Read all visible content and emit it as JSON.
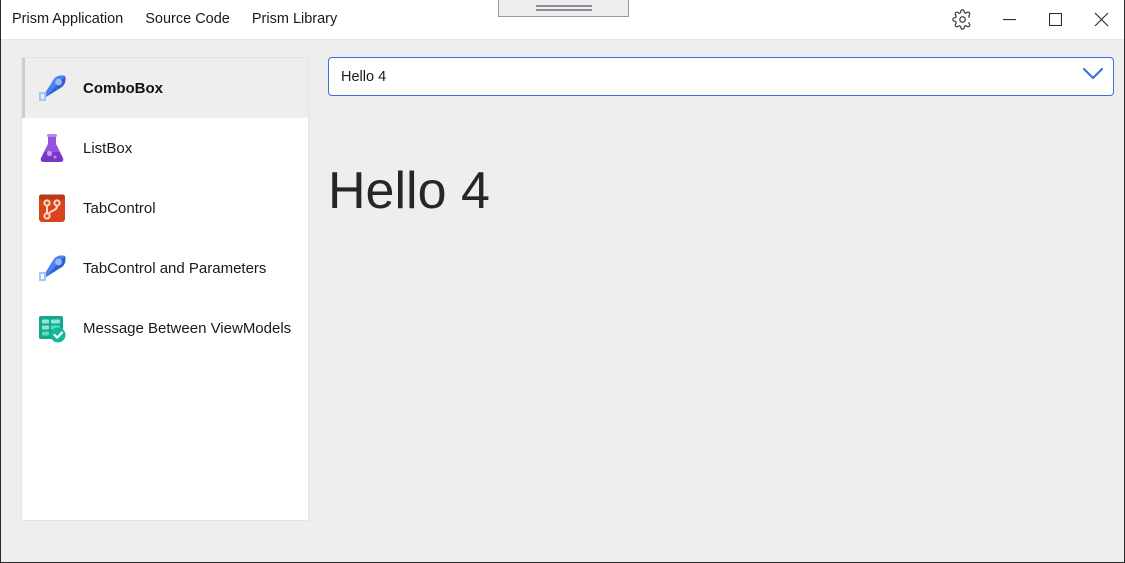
{
  "window": {
    "menu": [
      {
        "label": "Prism Application"
      },
      {
        "label": "Source Code"
      },
      {
        "label": "Prism Library"
      }
    ],
    "caption": {
      "settings_title": "Settings",
      "minimize_title": "Minimize",
      "maximize_title": "Maximize",
      "close_title": "Close"
    },
    "drag_handle_title": "Drag handle"
  },
  "sidebar": {
    "items": [
      {
        "label": "ComboBox",
        "icon": "rocket-icon",
        "selected": true
      },
      {
        "label": "ListBox",
        "icon": "flask-icon",
        "selected": false
      },
      {
        "label": "TabControl",
        "icon": "git-branch-icon",
        "selected": false
      },
      {
        "label": "TabControl and Parameters",
        "icon": "rocket-icon",
        "selected": false
      },
      {
        "label": "Message Between ViewModels",
        "icon": "board-check-icon",
        "selected": false
      }
    ]
  },
  "content": {
    "combobox": {
      "value": "Hello 4",
      "placeholder": "Hello 4",
      "arrow_icon": "chevron-down-icon"
    },
    "display_text": "Hello 4"
  },
  "colors": {
    "accent_blue": "#3a6fe0",
    "window_background": "#eeeeee",
    "panel_background": "#ffffff",
    "selected_item_background": "#eeeeee",
    "text_primary": "#1a1a1a",
    "display_text": "#262626"
  }
}
